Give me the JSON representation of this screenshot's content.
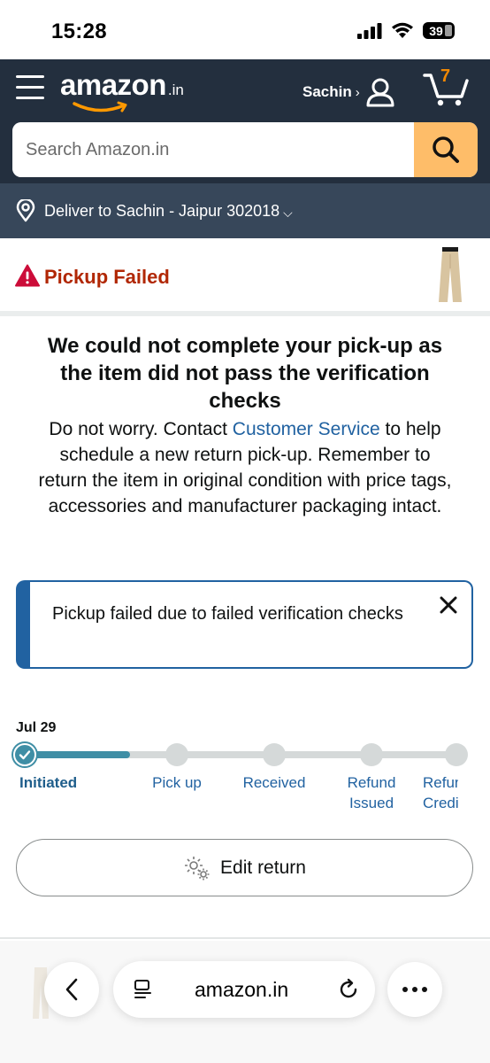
{
  "status_bar": {
    "time": "15:28",
    "battery": "39"
  },
  "header": {
    "logo_text": "amazon",
    "logo_suffix": ".in",
    "account_name": "Sachin",
    "account_caret": "›",
    "cart_count": "7"
  },
  "search": {
    "placeholder": "Search Amazon.in"
  },
  "deliver": {
    "text": "Deliver to Sachin - Jaipur 302018",
    "caret": "⌵"
  },
  "pickup": {
    "status": "Pickup Failed"
  },
  "message": {
    "title": "We could not complete your pick-up as the item did not pass the verification checks",
    "body_before_link": "Do not worry. Contact ",
    "link_text": "Customer Service",
    "body_after_link": " to help schedule a new return pick-up. Remember to return the item in original condition with price tags, accessories and manufacturer packaging intact."
  },
  "alert": {
    "text": "Pickup failed due to failed verification checks"
  },
  "timeline": {
    "date": "Jul 29",
    "progress_fraction": 0.25,
    "steps": [
      {
        "label": "Initiated",
        "status": "complete"
      },
      {
        "label": "Pick up",
        "status": "pending"
      },
      {
        "label": "Received",
        "status": "pending"
      },
      {
        "label": "Refund Issued",
        "status": "pending"
      },
      {
        "label": "Refund Credited",
        "status": "pending"
      }
    ]
  },
  "edit_return": {
    "label": "Edit return"
  },
  "browser": {
    "url": "amazon.in"
  },
  "colors": {
    "header_bg": "#232f3e",
    "deliver_bg": "#37475a",
    "search_button": "#febd69",
    "error_red": "#b12704",
    "link_blue": "#2162a1",
    "progress_teal": "#3f8ea5",
    "cart_orange": "#f08804"
  },
  "icons": [
    "menu-icon",
    "account-icon",
    "cart-icon",
    "search-icon",
    "location-pin-icon",
    "warning-icon",
    "close-icon",
    "check-icon",
    "gear-icon",
    "back-icon",
    "tabs-icon",
    "reload-icon",
    "more-icon"
  ]
}
